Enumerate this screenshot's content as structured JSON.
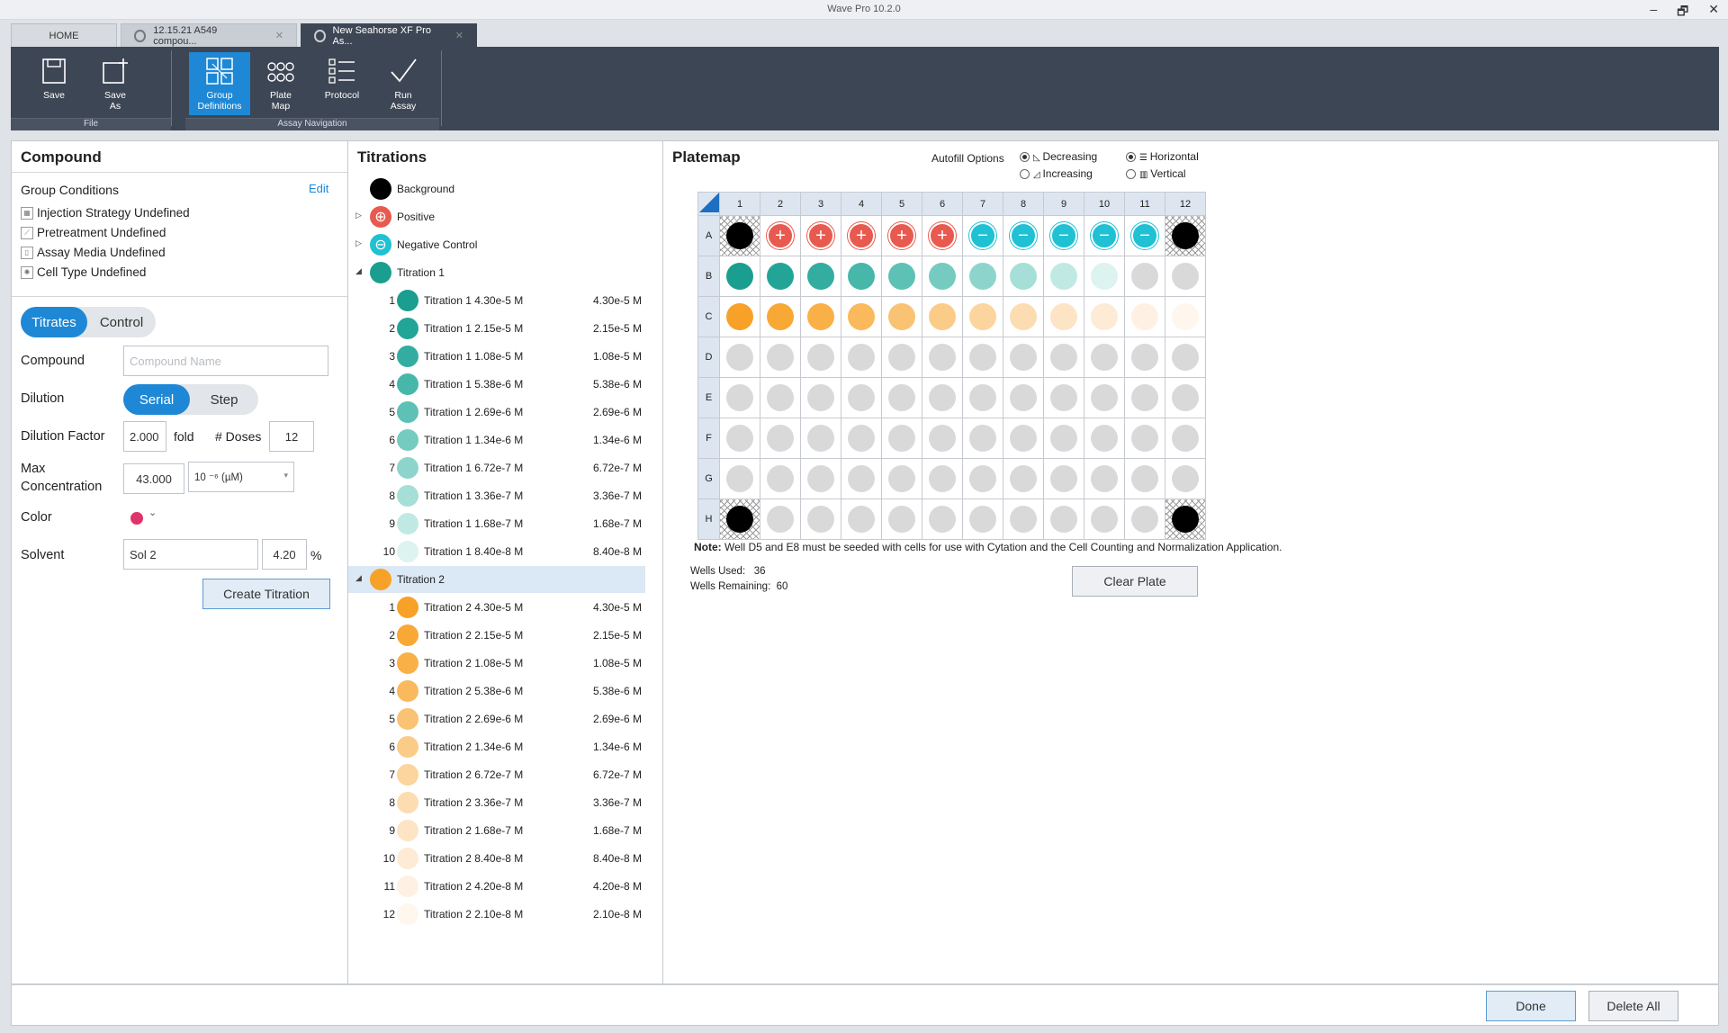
{
  "window": {
    "title": "Wave Pro 10.2.0",
    "controls": [
      "–",
      "🗗",
      "✕"
    ]
  },
  "tabs": [
    {
      "label": "HOME"
    },
    {
      "label": "12.15.21 A549 compou...",
      "close": "✕"
    },
    {
      "label": "New Seahorse XF Pro As...",
      "close": "✕"
    }
  ],
  "ribbon": {
    "file_group": "File",
    "nav_group": "Assay Navigation",
    "save": "Save",
    "save_as_1": "Save",
    "save_as_2": "As",
    "group_def_1": "Group",
    "group_def_2": "Definitions",
    "plate_map_1": "Plate",
    "plate_map_2": "Map",
    "protocol": "Protocol",
    "run_1": "Run",
    "run_2": "Assay"
  },
  "compound": {
    "title": "Compound",
    "group_conditions": "Group Conditions",
    "edit": "Edit",
    "conditions": [
      "Injection Strategy Undefined",
      "Pretreatment Undefined",
      "Assay Media Undefined",
      "Cell Type Undefined"
    ],
    "seg_titrates": "Titrates",
    "seg_control": "Control",
    "compound_label": "Compound",
    "compound_placeholder": "Compound Name",
    "dilution_label": "Dilution",
    "serial": "Serial",
    "step": "Step",
    "dilution_factor_label": "Dilution Factor",
    "dilution_factor": "2.000",
    "fold": "fold",
    "doses_label": "# Doses",
    "doses": "12",
    "max_conc_1": "Max",
    "max_conc_2": "Concentration",
    "max_conc_value": "43.000",
    "unit": "10 ⁻⁶ (µM)",
    "color_label": "Color",
    "color": "#e0336b",
    "solvent_label": "Solvent",
    "solvent": "Sol 2",
    "solvent_pct": "4.20",
    "pct": "%",
    "create": "Create Titration"
  },
  "titrations": {
    "title": "Titrations",
    "groups": [
      {
        "name": "Background",
        "color": "#000000"
      },
      {
        "name": "Positive",
        "color": "#e85a4f"
      },
      {
        "name": "Negative Control",
        "color": "#1fc1d3"
      },
      {
        "name": "Titration 1",
        "color": "#1a9e8f"
      }
    ],
    "t1": [
      {
        "n": "1",
        "label": "Titration 1 4.30e-5 M",
        "conc": "4.30e-5  M",
        "color": "#1a9e8f"
      },
      {
        "n": "2",
        "label": "Titration 1 2.15e-5 M",
        "conc": "2.15e-5  M",
        "color": "#22a597"
      },
      {
        "n": "3",
        "label": "Titration 1 1.08e-5 M",
        "conc": "1.08e-5  M",
        "color": "#33ad9f"
      },
      {
        "n": "4",
        "label": "Titration 1 5.38e-6 M",
        "conc": "5.38e-6  M",
        "color": "#47b7aa"
      },
      {
        "n": "5",
        "label": "Titration 1 2.69e-6 M",
        "conc": "2.69e-6  M",
        "color": "#5dc1b5"
      },
      {
        "n": "6",
        "label": "Titration 1 1.34e-6 M",
        "conc": "1.34e-6  M",
        "color": "#75cbc0"
      },
      {
        "n": "7",
        "label": "Titration 1 6.72e-7 M",
        "conc": "6.72e-7  M",
        "color": "#8dd5cc"
      },
      {
        "n": "8",
        "label": "Titration 1 3.36e-7 M",
        "conc": "3.36e-7  M",
        "color": "#a6dfd8"
      },
      {
        "n": "9",
        "label": "Titration 1 1.68e-7 M",
        "conc": "1.68e-7  M",
        "color": "#c1e9e4"
      },
      {
        "n": "10",
        "label": "Titration 1 8.40e-8 M",
        "conc": "8.40e-8  M",
        "color": "#dcf3f0"
      }
    ],
    "t2_name": "Titration 2",
    "t2_color": "#f7a128",
    "t2": [
      {
        "n": "1",
        "label": "Titration 2 4.30e-5 M",
        "conc": "4.30e-5  M",
        "color": "#f7a128"
      },
      {
        "n": "2",
        "label": "Titration 2 2.15e-5 M",
        "conc": "2.15e-5  M",
        "color": "#f8a835"
      },
      {
        "n": "3",
        "label": "Titration 2 1.08e-5 M",
        "conc": "1.08e-5  M",
        "color": "#f9b047"
      },
      {
        "n": "4",
        "label": "Titration 2 5.38e-6 M",
        "conc": "5.38e-6  M",
        "color": "#f9b95c"
      },
      {
        "n": "5",
        "label": "Titration 2 2.69e-6 M",
        "conc": "2.69e-6  M",
        "color": "#fac273"
      },
      {
        "n": "6",
        "label": "Titration 2 1.34e-6 M",
        "conc": "1.34e-6  M",
        "color": "#fbcb88"
      },
      {
        "n": "7",
        "label": "Titration 2 6.72e-7 M",
        "conc": "6.72e-7  M",
        "color": "#fcd49d"
      },
      {
        "n": "8",
        "label": "Titration 2 3.36e-7 M",
        "conc": "3.36e-7  M",
        "color": "#fcdcb1"
      },
      {
        "n": "9",
        "label": "Titration 2 1.68e-7 M",
        "conc": "1.68e-7  M",
        "color": "#fde4c4"
      },
      {
        "n": "10",
        "label": "Titration 2 8.40e-8 M",
        "conc": "8.40e-8  M",
        "color": "#feebd5"
      },
      {
        "n": "11",
        "label": "Titration 2 4.20e-8 M",
        "conc": "4.20e-8  M",
        "color": "#fef1e3"
      },
      {
        "n": "12",
        "label": "Titration 2 2.10e-8 M",
        "conc": "2.10e-8  M",
        "color": "#fff6ee"
      }
    ]
  },
  "platemap": {
    "title": "Platemap",
    "autofill_label": "Autofill Options",
    "decreasing": "Decreasing",
    "increasing": "Increasing",
    "horizontal": "Horizontal",
    "vertical": "Vertical",
    "cols": [
      "1",
      "2",
      "3",
      "4",
      "5",
      "6",
      "7",
      "8",
      "9",
      "10",
      "11",
      "12"
    ],
    "rows": [
      "A",
      "B",
      "C",
      "D",
      "E",
      "F",
      "G",
      "H"
    ],
    "empty_color": "#d9d9d9",
    "row_a": [
      "bg",
      "pos",
      "pos",
      "pos",
      "pos",
      "pos",
      "neg",
      "neg",
      "neg",
      "neg",
      "neg",
      "bg"
    ],
    "row_b": [
      "#1a9e8f",
      "#22a597",
      "#33ad9f",
      "#47b7aa",
      "#5dc1b5",
      "#75cbc0",
      "#8dd5cc",
      "#a6dfd8",
      "#c1e9e4",
      "#dcf3f0",
      "#d9d9d9",
      "#d9d9d9"
    ],
    "row_c": [
      "#f7a128",
      "#f8a835",
      "#f9b047",
      "#f9b95c",
      "#fac273",
      "#fbcb88",
      "#fcd49d",
      "#fcdcb1",
      "#fde4c4",
      "#feebd5",
      "#fef1e3",
      "#fff6ee"
    ],
    "row_h": [
      "bg",
      "e",
      "e",
      "e",
      "e",
      "e",
      "e",
      "e",
      "e",
      "e",
      "e",
      "bg"
    ],
    "note_bold": "Note:",
    "note": " Well D5 and E8 must be seeded with cells for use with Cytation and the Cell Counting and Normalization Application.",
    "wells_used_label": "Wells Used:",
    "wells_used": "36",
    "wells_remaining_label": "Wells Remaining:",
    "wells_remaining": "60",
    "clear": "Clear Plate"
  },
  "footer": {
    "done": "Done",
    "delete_all": "Delete All"
  }
}
